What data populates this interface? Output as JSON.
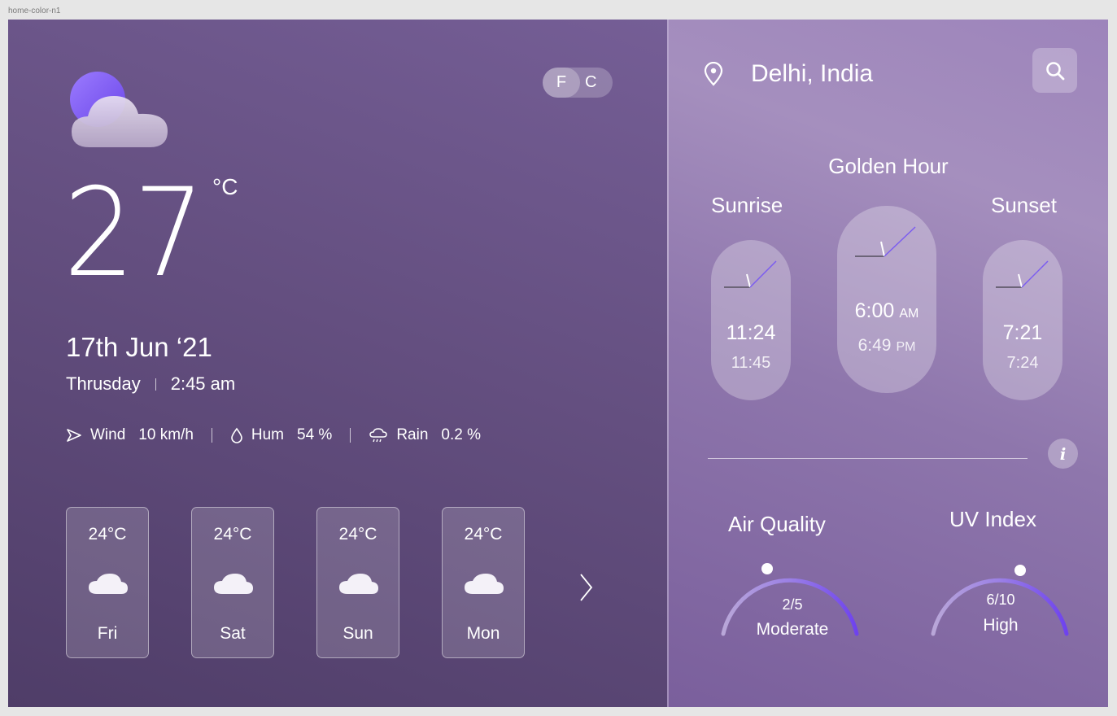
{
  "frame_label": "home-color-n1",
  "units": {
    "f": "F",
    "c": "C"
  },
  "current": {
    "temperature": "27",
    "unit": "°C",
    "date": "17th Jun ‘21",
    "day": "Thrusday",
    "time": "2:45 am"
  },
  "stats": {
    "wind_label": "Wind",
    "wind_value": "10 km/h",
    "hum_label": "Hum",
    "hum_value": "54 %",
    "rain_label": "Rain",
    "rain_value": "0.2 %"
  },
  "forecast": [
    {
      "temp": "24°C",
      "day": "Fri"
    },
    {
      "temp": "24°C",
      "day": "Sat"
    },
    {
      "temp": "24°C",
      "day": "Sun"
    },
    {
      "temp": "24°C",
      "day": "Mon"
    }
  ],
  "location": "Delhi, India",
  "golden_hour": {
    "title": "Golden Hour",
    "sunrise_label": "Sunrise",
    "sunset_label": "Sunset",
    "sunrise_time": "11:24",
    "sunrise_sub": "11:45",
    "center_time": "6:00",
    "center_time_ampm": "AM",
    "center_sub": "6:49",
    "center_sub_ampm": "PM",
    "sunset_time": "7:21",
    "sunset_sub": "7:24"
  },
  "info_label": "i",
  "air_quality": {
    "title": "Air Quality",
    "value": "2/5",
    "label": "Moderate",
    "level": 0.4
  },
  "uv_index": {
    "title": "UV Index",
    "value": "6/10",
    "label": "High",
    "level": 0.6
  },
  "colors": {
    "accent": "#7b5cf0",
    "left_bg": "#644f80",
    "right_bg": "#9d84bb"
  }
}
